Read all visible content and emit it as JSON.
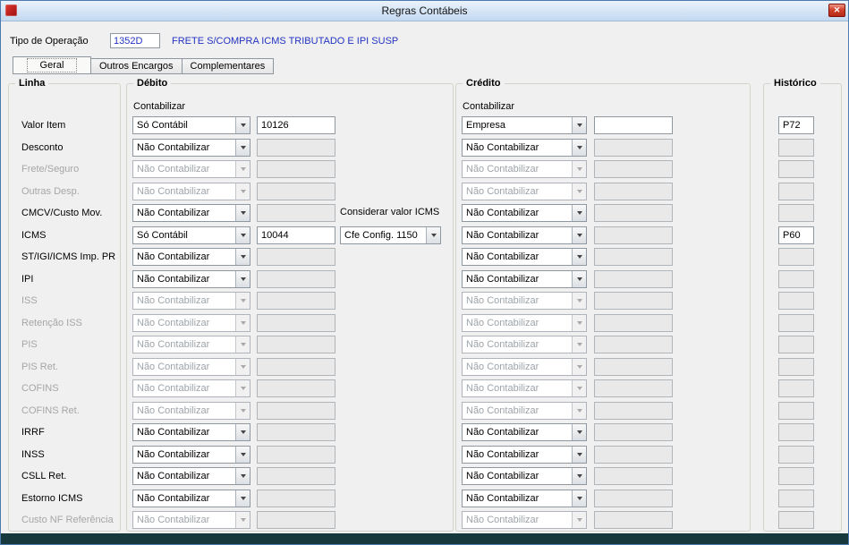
{
  "window": {
    "title": "Regras Contábeis",
    "close_icon": "✕"
  },
  "header": {
    "tipo_label": "Tipo de Operação",
    "tipo_value": "1352D",
    "tipo_description": "FRETE S/COMPRA ICMS TRIBUTADO E IPI SUSP"
  },
  "tabs": [
    {
      "label": "Geral",
      "selected": true
    },
    {
      "label": "Outros Encargos",
      "selected": false
    },
    {
      "label": "Complementares",
      "selected": false
    }
  ],
  "groups": {
    "linha": "Linha",
    "debito": "Débito",
    "credito": "Crédito",
    "historico": "Histórico"
  },
  "labels": {
    "contabilizar": "Contabilizar",
    "considerar_icms": "Considerar valor ICMS"
  },
  "colors": {
    "link_blue": "#2333C1",
    "close_red": "#C0392B",
    "bottom_bar": "#17383C",
    "disabled_text": "#A6A6A6"
  },
  "rows": [
    {
      "label": "Valor Item",
      "enabled": true,
      "debito": "Só Contábil",
      "debito_conta": "10126",
      "debito_conta_on": true,
      "credito": "Empresa",
      "credito_conta": "",
      "credito_conta_on": true,
      "historico": "P72",
      "historico_on": true
    },
    {
      "label": "Desconto",
      "enabled": true,
      "debito": "Não Contabilizar",
      "debito_conta": "",
      "debito_conta_on": false,
      "credito": "Não Contabilizar",
      "credito_conta": "",
      "credito_conta_on": false,
      "historico": "",
      "historico_on": false
    },
    {
      "label": "Frete/Seguro",
      "enabled": false,
      "debito": "Não Contabilizar",
      "debito_conta": "",
      "debito_conta_on": false,
      "credito": "Não Contabilizar",
      "credito_conta": "",
      "credito_conta_on": false,
      "historico": "",
      "historico_on": false
    },
    {
      "label": "Outras Desp.",
      "enabled": false,
      "debito": "Não Contabilizar",
      "debito_conta": "",
      "debito_conta_on": false,
      "credito": "Não Contabilizar",
      "credito_conta": "",
      "credito_conta_on": false,
      "historico": "",
      "historico_on": false
    },
    {
      "label": "CMCV/Custo Mov.",
      "enabled": true,
      "debito": "Não Contabilizar",
      "debito_conta": "",
      "debito_conta_on": false,
      "credito": "Não Contabilizar",
      "credito_conta": "",
      "credito_conta_on": false,
      "historico": "",
      "historico_on": false
    },
    {
      "label": "ICMS",
      "enabled": true,
      "debito": "Só Contábil",
      "debito_conta": "10044",
      "debito_conta_on": true,
      "icms_option": "Cfe Config. 1150",
      "credito": "Não Contabilizar",
      "credito_conta": "",
      "credito_conta_on": false,
      "historico": "P60",
      "historico_on": true
    },
    {
      "label": "ST/IGI/ICMS Imp. PR",
      "enabled": true,
      "debito": "Não Contabilizar",
      "debito_conta": "",
      "debito_conta_on": false,
      "credito": "Não Contabilizar",
      "credito_conta": "",
      "credito_conta_on": false,
      "historico": "",
      "historico_on": false
    },
    {
      "label": "IPI",
      "enabled": true,
      "debito": "Não Contabilizar",
      "debito_conta": "",
      "debito_conta_on": false,
      "credito": "Não Contabilizar",
      "credito_conta": "",
      "credito_conta_on": false,
      "historico": "",
      "historico_on": false
    },
    {
      "label": "ISS",
      "enabled": false,
      "debito": "Não Contabilizar",
      "debito_conta": "",
      "debito_conta_on": false,
      "credito": "Não Contabilizar",
      "credito_conta": "",
      "credito_conta_on": false,
      "historico": "",
      "historico_on": false
    },
    {
      "label": "Retenção ISS",
      "enabled": false,
      "debito": "Não Contabilizar",
      "debito_conta": "",
      "debito_conta_on": false,
      "credito": "Não Contabilizar",
      "credito_conta": "",
      "credito_conta_on": false,
      "historico": "",
      "historico_on": false
    },
    {
      "label": "PIS",
      "enabled": false,
      "debito": "Não Contabilizar",
      "debito_conta": "",
      "debito_conta_on": false,
      "credito": "Não Contabilizar",
      "credito_conta": "",
      "credito_conta_on": false,
      "historico": "",
      "historico_on": false
    },
    {
      "label": "PIS Ret.",
      "enabled": false,
      "debito": "Não Contabilizar",
      "debito_conta": "",
      "debito_conta_on": false,
      "credito": "Não Contabilizar",
      "credito_conta": "",
      "credito_conta_on": false,
      "historico": "",
      "historico_on": false
    },
    {
      "label": "COFINS",
      "enabled": false,
      "debito": "Não Contabilizar",
      "debito_conta": "",
      "debito_conta_on": false,
      "credito": "Não Contabilizar",
      "credito_conta": "",
      "credito_conta_on": false,
      "historico": "",
      "historico_on": false
    },
    {
      "label": "COFINS Ret.",
      "enabled": false,
      "debito": "Não Contabilizar",
      "debito_conta": "",
      "debito_conta_on": false,
      "credito": "Não Contabilizar",
      "credito_conta": "",
      "credito_conta_on": false,
      "historico": "",
      "historico_on": false
    },
    {
      "label": "IRRF",
      "enabled": true,
      "debito": "Não Contabilizar",
      "debito_conta": "",
      "debito_conta_on": false,
      "credito": "Não Contabilizar",
      "credito_conta": "",
      "credito_conta_on": false,
      "historico": "",
      "historico_on": false
    },
    {
      "label": "INSS",
      "enabled": true,
      "debito": "Não Contabilizar",
      "debito_conta": "",
      "debito_conta_on": false,
      "credito": "Não Contabilizar",
      "credito_conta": "",
      "credito_conta_on": false,
      "historico": "",
      "historico_on": false
    },
    {
      "label": "CSLL Ret.",
      "enabled": true,
      "debito": "Não Contabilizar",
      "debito_conta": "",
      "debito_conta_on": false,
      "credito": "Não Contabilizar",
      "credito_conta": "",
      "credito_conta_on": false,
      "historico": "",
      "historico_on": false
    },
    {
      "label": "Estorno ICMS",
      "enabled": true,
      "debito": "Não Contabilizar",
      "debito_conta": "",
      "debito_conta_on": false,
      "credito": "Não Contabilizar",
      "credito_conta": "",
      "credito_conta_on": false,
      "historico": "",
      "historico_on": false
    },
    {
      "label": "Custo NF Referência",
      "enabled": false,
      "debito": "Não Contabilizar",
      "debito_conta": "",
      "debito_conta_on": false,
      "credito": "Não Contabilizar",
      "credito_conta": "",
      "credito_conta_on": false,
      "historico": "",
      "historico_on": false
    }
  ]
}
